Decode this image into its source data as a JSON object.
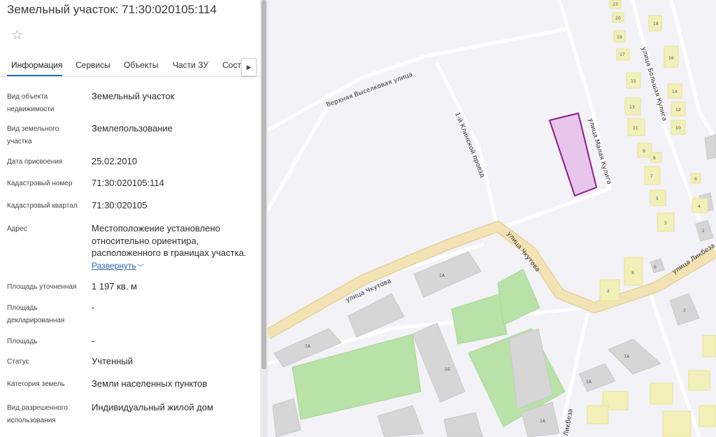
{
  "title": "Земельный участок: 71:30:020105:114",
  "icons": {
    "favorite": "star-outline-icon",
    "tabs_next": "triangle-right-icon",
    "expand": "chevron-down-icon"
  },
  "tabs": [
    {
      "label": "Информация",
      "active": true
    },
    {
      "label": "Сервисы",
      "active": false
    },
    {
      "label": "Объекты",
      "active": false
    },
    {
      "label": "Части ЗУ",
      "active": false
    },
    {
      "label": "Соста",
      "active": false
    }
  ],
  "fields": [
    {
      "label": "Вид объекта недвижимости",
      "value": "Земельный участок"
    },
    {
      "label": "Вид земельного участка",
      "value": "Землепользование"
    },
    {
      "label": "Дата присвоения",
      "value": "25.02.2010"
    },
    {
      "label": "Кадастровый номер",
      "value": "71:30:020105:114"
    },
    {
      "label": "Кадастровый квартал",
      "value": "71:30:020105"
    },
    {
      "label": "Адрес",
      "value": "Местоположение установлено относительно ориентира, расположенного в границах участка."
    },
    {
      "label": "Площадь уточненная",
      "value": "1 197 кв. м"
    },
    {
      "label": "Площадь декларированная",
      "value": "-"
    },
    {
      "label": "Площадь",
      "value": "-"
    },
    {
      "label": "Статус",
      "value": "Учтенный"
    },
    {
      "label": "Категория земель",
      "value": "Земли населенных пунктов"
    },
    {
      "label": "Вид разрешенного использования",
      "value": "Индивидуальный жилой дом"
    }
  ],
  "expand_label": "Развернуть",
  "map": {
    "colors": {
      "background": "#f3f2f7",
      "road": "#f3e3b4",
      "building": "#d6d6d6",
      "house": "#f2f0b8",
      "park": "#b8e2a8",
      "parcel_fill": "#e8c6ec",
      "parcel_stroke": "#8a1f84"
    },
    "streets": {
      "verkhnyaya": "Верхняя Выселковая улица",
      "proezd": "1-й Клинской проезд",
      "malaya": "улица Малая Кулига",
      "bolshaya": "улица Большая Кулига",
      "chutova_left": "улица Чкутова",
      "chutova_right": "улица Чкутова",
      "likbeza_top": "улица Ликбеза",
      "likbeza_bottom": "Ликбеза"
    },
    "house_numbers": [
      "23",
      "18",
      "20",
      "19",
      "16",
      "17",
      "14",
      "15",
      "12",
      "13",
      "10",
      "11",
      "9",
      "8",
      "7",
      "6",
      "5",
      "4",
      "3",
      "2",
      "3А",
      "1А",
      "1Б",
      "3А",
      "7А",
      "1А",
      "3",
      "6",
      "8",
      "2"
    ]
  }
}
